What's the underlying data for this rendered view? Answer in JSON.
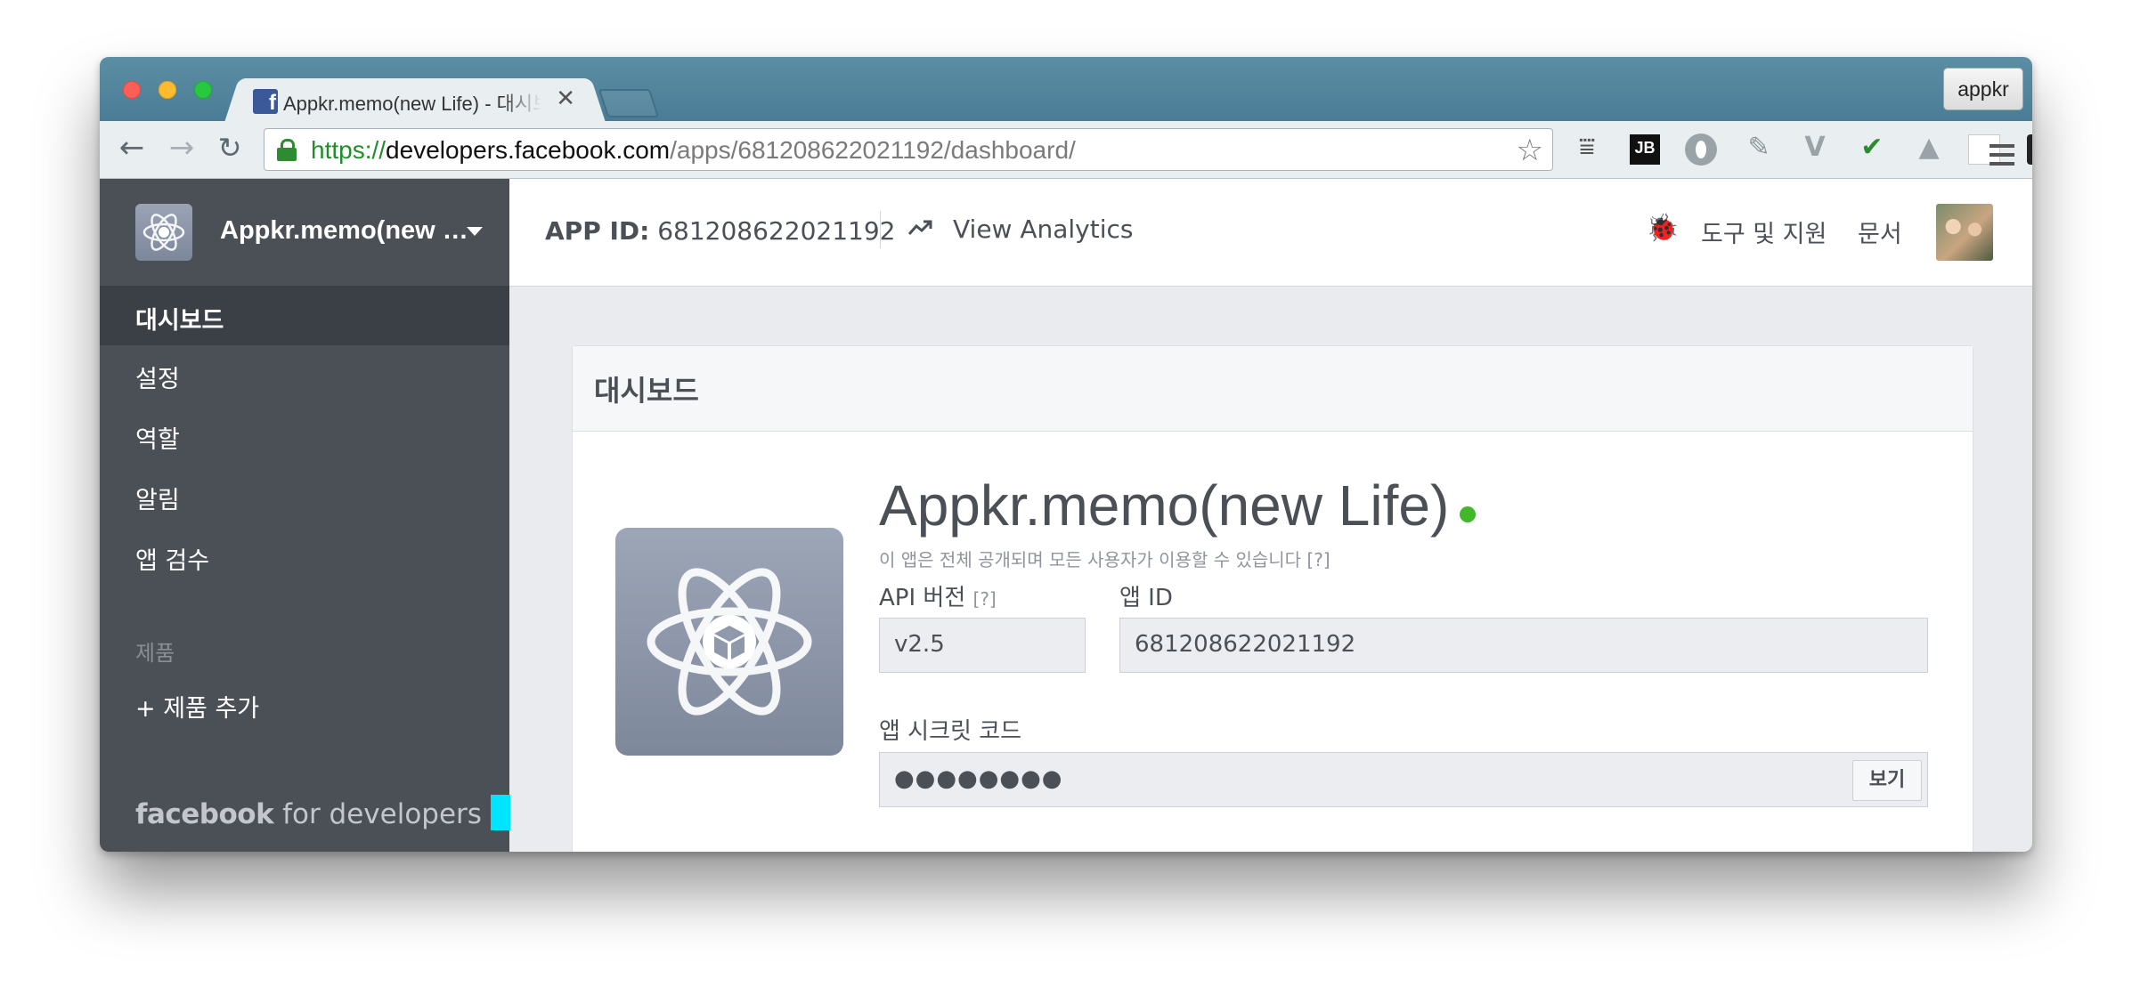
{
  "browser": {
    "tab_title": "Appkr.memo(new Life) - 대시보드",
    "profile_name": "appkr",
    "url": {
      "scheme": "https://",
      "host": "developers.facebook.com",
      "path": "/apps/681208622021192/dashboard/"
    },
    "extensions": [
      "ublock-icon",
      "jetbrains-icon",
      "opera-icon",
      "feather-icon",
      "vue-icon",
      "abc-check-icon",
      "drive-icon",
      "page-icon",
      "s-icon"
    ]
  },
  "sidebar": {
    "app_name": "Appkr.memo(new Life)",
    "items": [
      {
        "label": "대시보드",
        "active": true
      },
      {
        "label": "설정"
      },
      {
        "label": "역할"
      },
      {
        "label": "알림"
      },
      {
        "label": "앱 검수"
      }
    ],
    "section_label": "제품",
    "add_product": "+ 제품 추가",
    "footer_brand": "facebook",
    "footer_suffix": "for developers"
  },
  "topbar": {
    "app_id_label": "APP ID:",
    "app_id_value": "681208622021192",
    "analytics_label": "View Analytics",
    "tools_label": "도구 및 지원",
    "docs_label": "문서"
  },
  "dashboard": {
    "title": "대시보드",
    "app_name": "Appkr.memo(new Life)",
    "public_note": "이 앱은 전체 공개되며 모든 사용자가 이용할 수 있습니다 [?]",
    "api_version_label": "API 버전",
    "help_marker": "[?]",
    "api_version_value": "v2.5",
    "app_id_label": "앱 ID",
    "app_id_value": "681208622021192",
    "secret_label": "앱 시크릿 코드",
    "secret_value": "●●●●●●●●",
    "show_button": "보기",
    "status_color": "#42b72a"
  },
  "colors": {
    "sidebar_bg": "#4b4f56",
    "brand_blue": "#3b5998",
    "accent_cursor": "#00e5ff"
  }
}
